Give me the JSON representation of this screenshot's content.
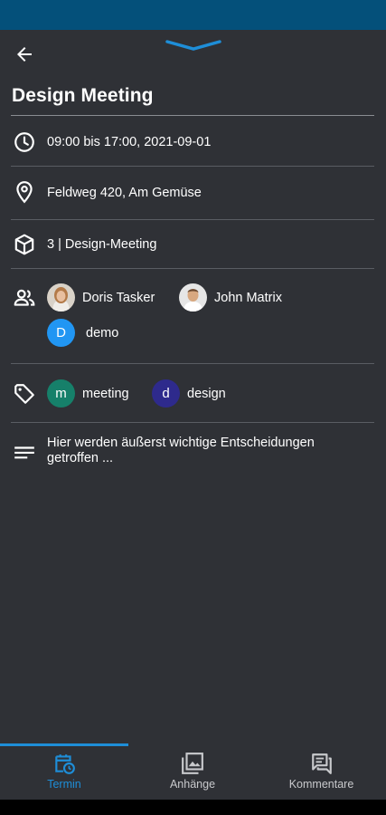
{
  "event": {
    "title": "Design Meeting",
    "time": "09:00 bis 17:00, 2021-09-01",
    "location": "Feldweg 420, Am Gemüse",
    "project": "3 | Design-Meeting",
    "description": "Hier werden äußerst wichtige Entscheidungen getroffen ..."
  },
  "participants": [
    {
      "name": "Doris Tasker",
      "avatar": "photo"
    },
    {
      "name": "John Matrix",
      "avatar": "photo"
    },
    {
      "name": "demo",
      "avatar_letter": "D",
      "color": "#2196f3"
    }
  ],
  "tags": [
    {
      "letter": "m",
      "label": "meeting",
      "color": "#16806a"
    },
    {
      "letter": "d",
      "label": "design",
      "color": "#2e2a8c"
    }
  ],
  "tabs": [
    {
      "label": "Termin",
      "icon": "calendar-clock-icon",
      "active": true
    },
    {
      "label": "Anhänge",
      "icon": "image-gallery-icon",
      "active": false
    },
    {
      "label": "Kommentare",
      "icon": "comments-icon",
      "active": false
    }
  ],
  "colors": {
    "accent": "#1e8ed8",
    "background": "#2f3136",
    "statusbar": "#04507a"
  }
}
